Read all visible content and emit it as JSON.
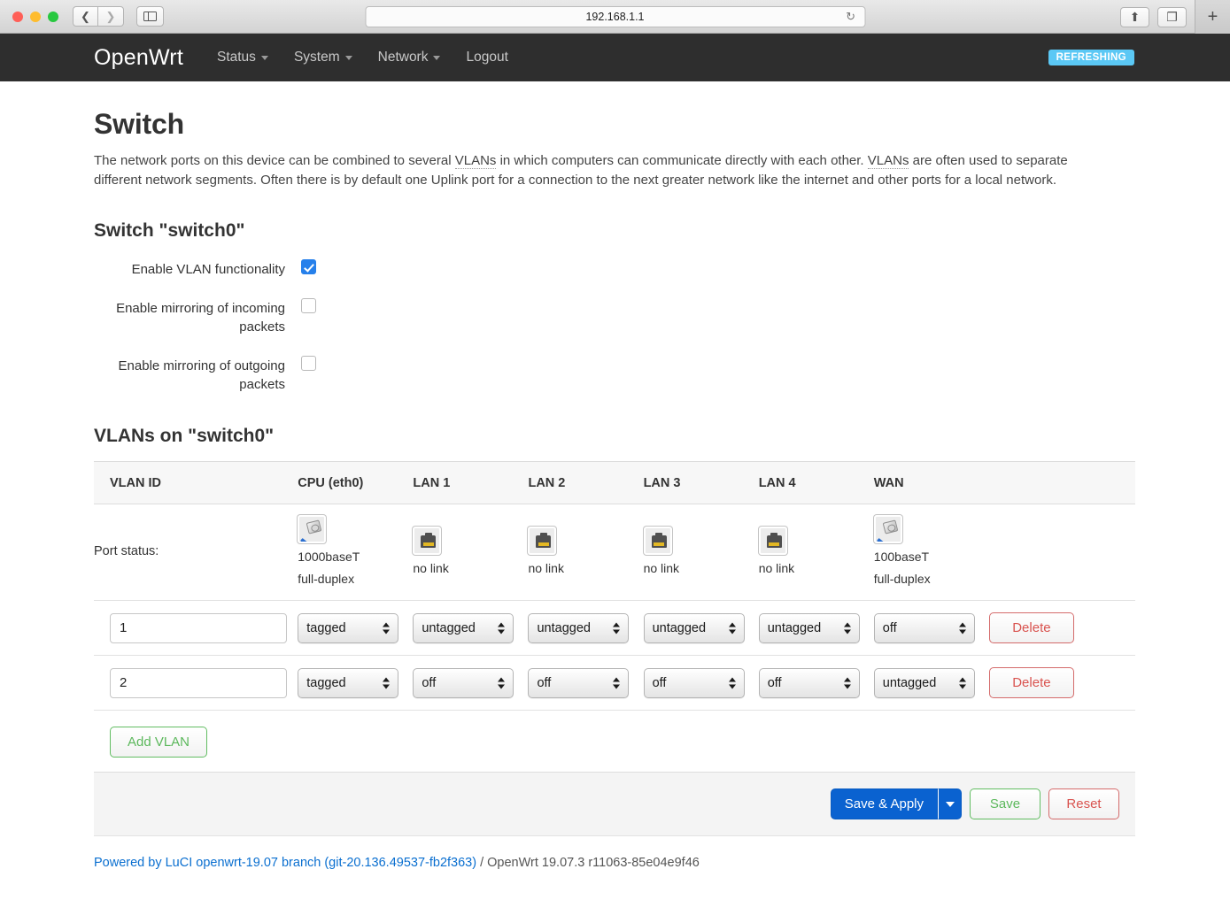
{
  "browser": {
    "url": "192.168.1.1",
    "back_icon": "chevron-left-icon",
    "forward_icon": "chevron-right-icon",
    "sidebar_icon": "sidebar-icon",
    "reload_icon": "↻",
    "share_icon": "⬆",
    "tabs_icon": "❐",
    "newtab_label": "+"
  },
  "header": {
    "brand": "OpenWrt",
    "nav": [
      {
        "label": "Status",
        "has_caret": true
      },
      {
        "label": "System",
        "has_caret": true
      },
      {
        "label": "Network",
        "has_caret": true
      },
      {
        "label": "Logout",
        "has_caret": false
      }
    ],
    "status_badge": "REFRESHING",
    "badge_color": "#5bc8f5"
  },
  "page": {
    "title": "Switch",
    "description_part1": "The network ports on this device can be combined to several ",
    "abbr1": "VLANs",
    "description_part2": " in which computers can communicate directly with each other. ",
    "abbr2": "VLANs",
    "description_part3": " are often used to separate different network segments. Often there is by default one Uplink port for a connection to the next greater network like the internet and other ports for a local network."
  },
  "switch_section": {
    "title": "Switch \"switch0\"",
    "options": [
      {
        "label": "Enable VLAN functionality",
        "checked": true
      },
      {
        "label": "Enable mirroring of incoming packets",
        "checked": false
      },
      {
        "label": "Enable mirroring of outgoing packets",
        "checked": false
      }
    ]
  },
  "vlan_section": {
    "title": "VLANs on \"switch0\"",
    "columns": [
      "VLAN ID",
      "CPU (eth0)",
      "LAN 1",
      "LAN 2",
      "LAN 3",
      "LAN 4",
      "WAN",
      ""
    ],
    "port_status_label": "Port status:",
    "port_status": [
      {
        "port": "CPU (eth0)",
        "linked": true,
        "speed": "1000baseT",
        "duplex": "full-duplex"
      },
      {
        "port": "LAN 1",
        "linked": false,
        "speed": "no link",
        "duplex": ""
      },
      {
        "port": "LAN 2",
        "linked": false,
        "speed": "no link",
        "duplex": ""
      },
      {
        "port": "LAN 3",
        "linked": false,
        "speed": "no link",
        "duplex": ""
      },
      {
        "port": "LAN 4",
        "linked": false,
        "speed": "no link",
        "duplex": ""
      },
      {
        "port": "WAN",
        "linked": true,
        "speed": "100baseT",
        "duplex": "full-duplex"
      }
    ],
    "rows": [
      {
        "vlan_id": "1",
        "values": [
          "tagged",
          "untagged",
          "untagged",
          "untagged",
          "untagged",
          "off"
        ],
        "delete_label": "Delete"
      },
      {
        "vlan_id": "2",
        "values": [
          "tagged",
          "off",
          "off",
          "off",
          "off",
          "untagged"
        ],
        "delete_label": "Delete"
      }
    ],
    "add_vlan_label": "Add VLAN"
  },
  "actions": {
    "save_apply_label": "Save & Apply",
    "save_label": "Save",
    "reset_label": "Reset"
  },
  "footer": {
    "link": "Powered by LuCI openwrt-19.07 branch (git-20.136.49537-fb2f363)",
    "version": " / OpenWrt 19.07.3 r11063-85e04e9f46"
  }
}
